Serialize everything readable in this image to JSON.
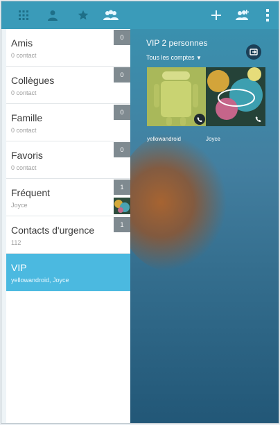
{
  "groups": [
    {
      "name": "Amis",
      "sub": "0 contact",
      "count": "0"
    },
    {
      "name": "Collègues",
      "sub": "0 contact",
      "count": "0"
    },
    {
      "name": "Famille",
      "sub": "0 contact",
      "count": "0"
    },
    {
      "name": "Favoris",
      "sub": "0 contact",
      "count": "0"
    },
    {
      "name": "Fréquent",
      "sub": "Joyce",
      "count": "1"
    },
    {
      "name": "Contacts d'urgence",
      "sub": "112",
      "count": "1"
    },
    {
      "name": "VIP",
      "sub": "yellowandroid, Joyce",
      "count": ""
    }
  ],
  "vip": {
    "title": "VIP 2 personnes",
    "filter": "Tous les comptes",
    "contacts": [
      {
        "name": "yellowandroid"
      },
      {
        "name": "Joyce"
      }
    ]
  },
  "icons": {
    "keypad": "dialpad-icon",
    "people": "person-icon",
    "favorites": "star-icon",
    "groups": "groups-icon",
    "add": "plus-icon",
    "add_group": "add-group-icon",
    "overflow": "more-vert-icon"
  },
  "colors": {
    "topbar": "#3a9bb9",
    "selected": "#4bb9e0",
    "badge": "#7f8a90"
  }
}
